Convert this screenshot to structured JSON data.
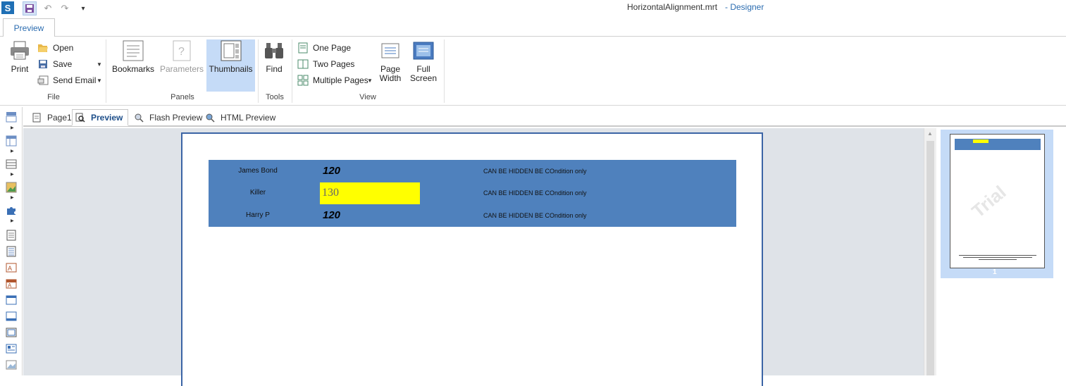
{
  "window": {
    "filename": "HorizontalAlignment.mrt",
    "app_suffix": " - Designer"
  },
  "ribbon": {
    "tab": "Preview",
    "groups": {
      "file": "File",
      "panels": "Panels",
      "tools": "Tools",
      "view": "View"
    },
    "buttons": {
      "print": "Print",
      "open": "Open",
      "save": "Save",
      "send_email": "Send Email",
      "bookmarks": "Bookmarks",
      "parameters": "Parameters",
      "thumbnails": "Thumbnails",
      "find": "Find",
      "one_page": "One Page",
      "two_pages": "Two Pages",
      "multiple_pages": "Multiple Pages",
      "page_width_1": "Page",
      "page_width_2": "Width",
      "full_screen_1": "Full",
      "full_screen_2": "Screen"
    }
  },
  "doc_tabs": [
    {
      "label": "Page1",
      "active": false
    },
    {
      "label": "Preview",
      "active": true
    },
    {
      "label": "Flash Preview",
      "active": false
    },
    {
      "label": "HTML Preview",
      "active": false
    }
  ],
  "report": {
    "band_color": "#4f81bd",
    "highlight_color": "#ffff00",
    "rows": [
      {
        "name": "James Bond",
        "value": "120",
        "note": "CAN BE HIDDEN BE COndition only"
      },
      {
        "name": "Killer",
        "value": "130",
        "note": "CAN BE HIDDEN BE COndition only",
        "highlighted": true
      },
      {
        "name": "Harry P",
        "value": "120",
        "note": "CAN BE HIDDEN BE COndition only"
      }
    ]
  },
  "thumbnails": {
    "watermark": "Trial",
    "page_number": "1"
  }
}
